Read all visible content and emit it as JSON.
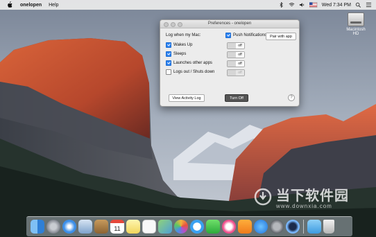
{
  "menubar": {
    "app_name": "onelopen",
    "menus": [
      "Help"
    ],
    "clock": "Wed 7:34 PM"
  },
  "desktop": {
    "disk_label": "Macintosh HD",
    "watermark_text": "当下软件园",
    "watermark_url": "www.downxia.com"
  },
  "window": {
    "title": "Preferences - onelopen",
    "heading": "Log when my Mac:",
    "events": [
      {
        "label": "Wakes Up",
        "checked": true,
        "value": "off"
      },
      {
        "label": "Sleeps",
        "checked": true,
        "value": "off"
      },
      {
        "label": "Launches other apps",
        "checked": true,
        "value": "off"
      },
      {
        "label": "Logs out / Shuts down",
        "checked": false,
        "value": "off"
      }
    ],
    "push_label": "Push Notifications:",
    "push_checked": true,
    "pair_button": "Pair with app",
    "view_log_button": "View Activity Log",
    "turn_off_button": "Turn Off",
    "help_glyph": "?"
  },
  "dock": {
    "apps": [
      "finder",
      "launchpad",
      "safari",
      "mail",
      "contacts",
      "calendar",
      "notes",
      "reminders",
      "maps",
      "photos",
      "messages",
      "facetime",
      "itunes",
      "ibooks",
      "app-store",
      "system-preferences",
      "onelopen",
      "downloads-folder",
      "trash"
    ],
    "calendar_day": "11"
  }
}
